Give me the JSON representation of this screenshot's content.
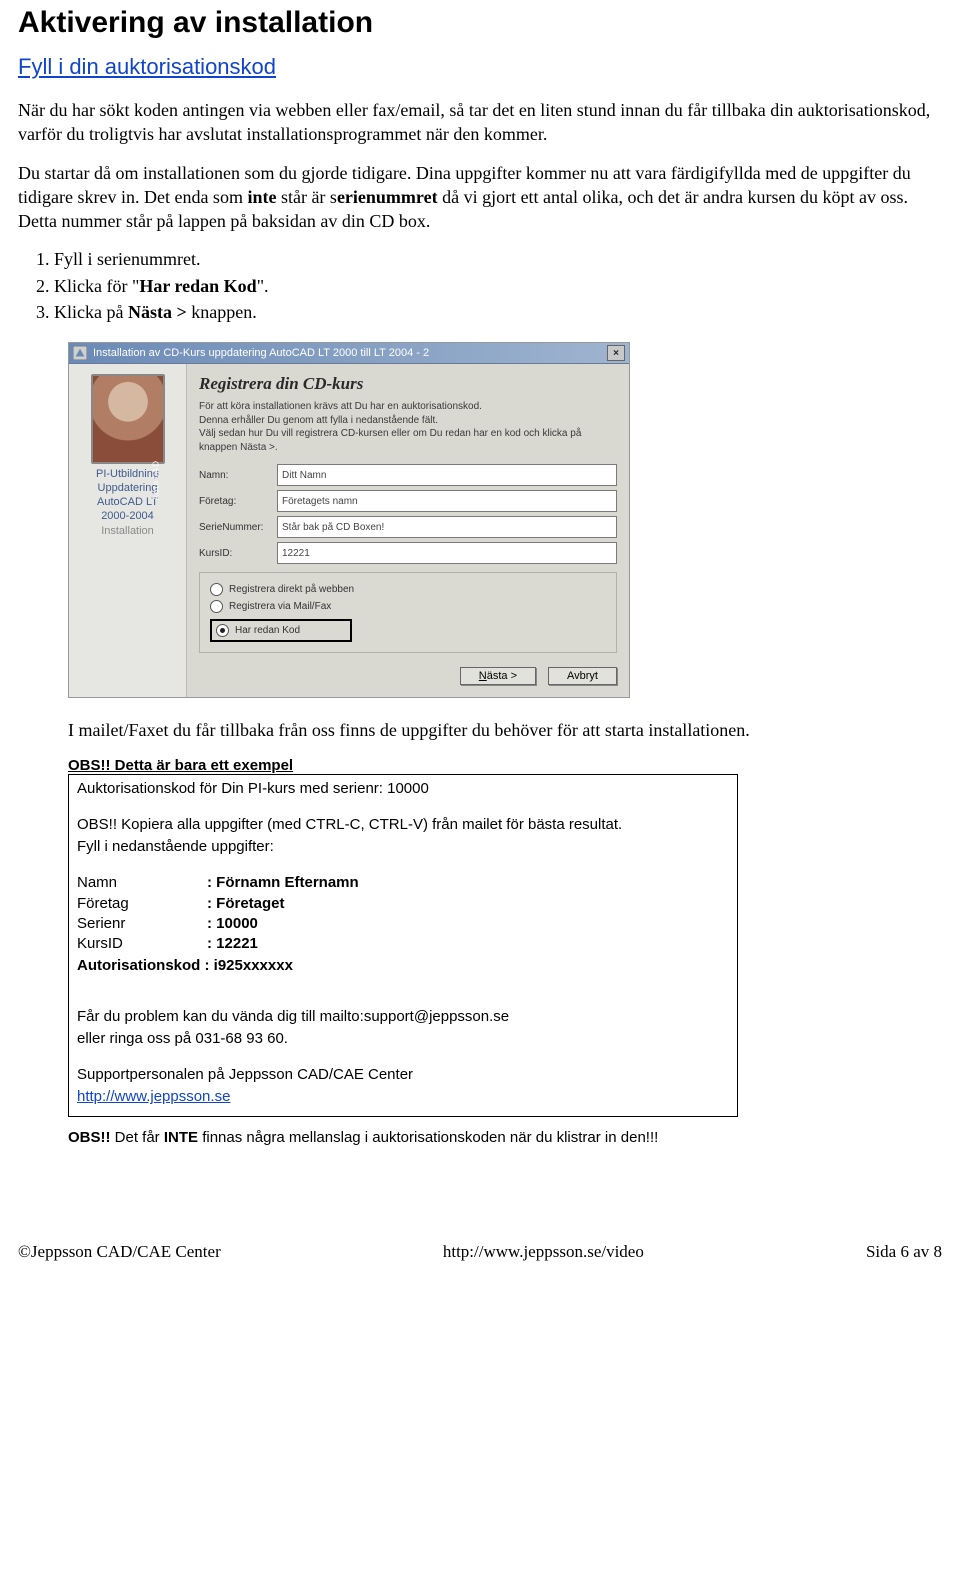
{
  "heading": "Aktivering av installation",
  "subheading": "Fyll i din auktorisationskod",
  "para1_a": "När du har sökt koden antingen via webben eller fax/email, så tar det en liten stund innan du får tillbaka din auktorisationskod, varför du troligtvis har avslutat installationsprogrammet när den kommer.",
  "para2_a": "Du startar då om installationen som du gjorde tidigare. Dina uppgifter kommer nu att vara färdigifyllda med de uppgifter du tidigare skrev in. Det enda som ",
  "para2_b": "inte",
  "para2_c": " står är s",
  "para2_d": "erienummret",
  "para2_e": " då vi gjort ett antal olika, och det är andra kursen du köpt av oss. Detta nummer står på lappen på baksidan av din CD box.",
  "steps": {
    "s1": "Fyll i serienummret.",
    "s2a": "Klicka för \"",
    "s2b": "Har redan Kod",
    "s2c": "\".",
    "s3a": "Klicka på ",
    "s3b": "Nästa >",
    "s3c": " knappen."
  },
  "dialog": {
    "title": "Installation av CD-Kurs uppdatering AutoCAD LT 2000 till LT 2004 - 2",
    "side1": "PI-Utbildning",
    "side2": "Uppdatering",
    "side3": "AutoCAD LT",
    "side4": "2000-2004",
    "side5": "Installation",
    "autocad": "AutoCAD",
    "header": "Registrera din CD-kurs",
    "desc": "För att köra installationen krävs att Du har en auktorisationskod.\nDenna erhåller Du genom att fylla i nedanstående fält.\nVälj sedan hur Du vill registrera CD-kursen eller om Du redan har en kod och klicka på knappen Nästa >.",
    "lbl_name": "Namn:",
    "lbl_comp": "Företag:",
    "lbl_serie": "SerieNummer:",
    "lbl_kurs": "KursID:",
    "val_name": "Ditt Namn",
    "val_comp": "Företagets namn",
    "val_serie": "Står bak på CD Boxen!",
    "val_kurs": "12221",
    "opt1": "Registrera direkt på webben",
    "opt2": "Registrera via Mail/Fax",
    "opt3": "Har redan Kod",
    "btn_next": "Nästa >",
    "btn_cancel": "Avbryt"
  },
  "after_para": "I mailet/Faxet du får tillbaka från oss finns de uppgifter du behöver för att starta installationen.",
  "obs_title": "OBS!! Detta är bara ett exempel",
  "mail": {
    "l1": "Auktorisationskod för Din PI-kurs med serienr: 10000",
    "l2": "OBS!! Kopiera alla uppgifter (med CTRL-C, CTRL-V) från mailet för bästa resultat.",
    "l3": "Fyll i nedanstående uppgifter:",
    "k1": "Namn",
    "v1": ": Förnamn Efternamn",
    "k2": "Företag",
    "v2": ": Företaget",
    "k3": "Serienr",
    "v3": ": 10000",
    "k4": "KursID",
    "v4": ": 12221",
    "k5": "Autorisationskod : i925xxxxxx",
    "p1": "Får du problem kan du vända dig till mailto:support@jeppsson.se",
    "p2": "eller ringa oss på 031-68 93 60.",
    "p3": "Supportpersonalen på Jeppsson CAD/CAE Center",
    "link": "http://www.jeppsson.se"
  },
  "final_a": "OBS!!",
  "final_b": " Det får ",
  "final_c": "INTE",
  "final_d": " finnas några mellanslag i auktorisationskoden när du klistrar in den!!!",
  "footer": {
    "left": "©Jeppsson CAD/CAE Center",
    "mid": "http://www.jeppsson.se/video",
    "right": "Sida 6 av 8"
  }
}
